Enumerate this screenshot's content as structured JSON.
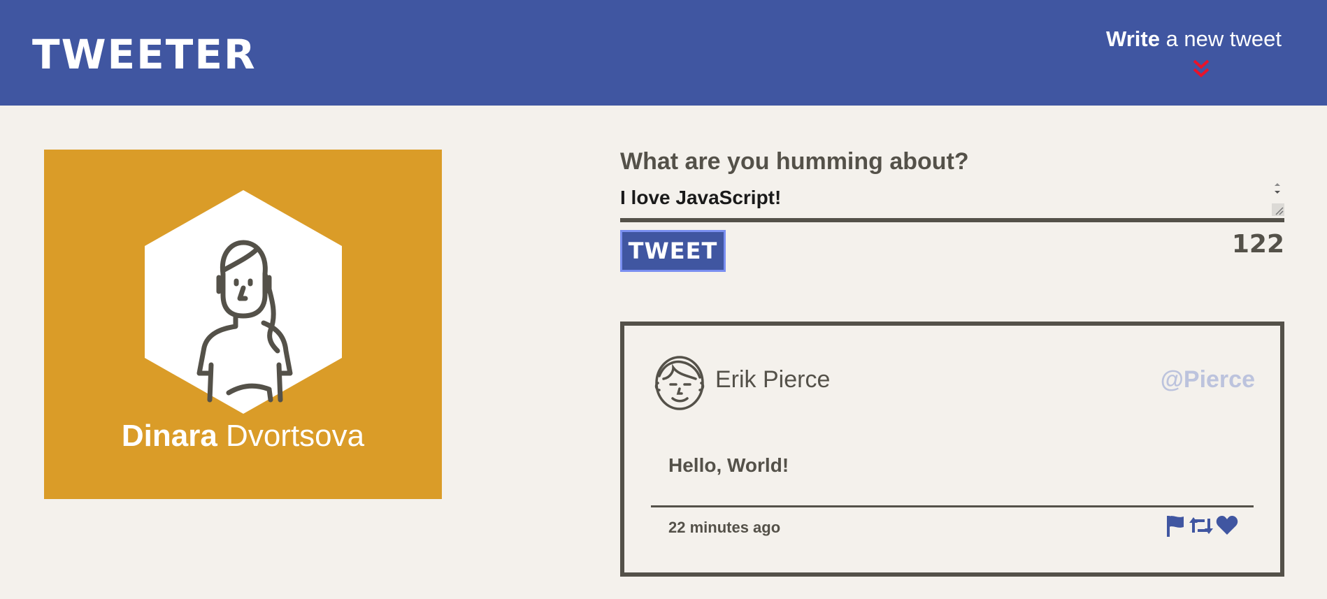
{
  "nav": {
    "brand": "TWEETER",
    "write_bold": "Write",
    "write_rest": " a new tweet",
    "icons": {
      "write_toggle": "double-chevron-down-icon"
    },
    "colors": {
      "bar": "#4056a1",
      "chevron": "#e8132a"
    }
  },
  "profile": {
    "first_name": "Dinara",
    "last_name": " Dvortsova",
    "icons": {
      "avatar": "woman-avatar-icon"
    },
    "colors": {
      "card": "#da9c28"
    }
  },
  "compose": {
    "label": "What are you humming about?",
    "text": "I love JavaScript!",
    "button_label": "TWEET",
    "counter": "122"
  },
  "tweet": {
    "name": "Erik Pierce",
    "handle": "@Pierce",
    "content": "Hello, World!",
    "time": "22 minutes ago",
    "icons": {
      "avatar": "man-avatar-icon",
      "flag": "flag-icon",
      "retweet": "retweet-icon",
      "like": "heart-icon"
    },
    "colors": {
      "actions": "#4056a1",
      "handle": "#bcc3dd"
    }
  }
}
